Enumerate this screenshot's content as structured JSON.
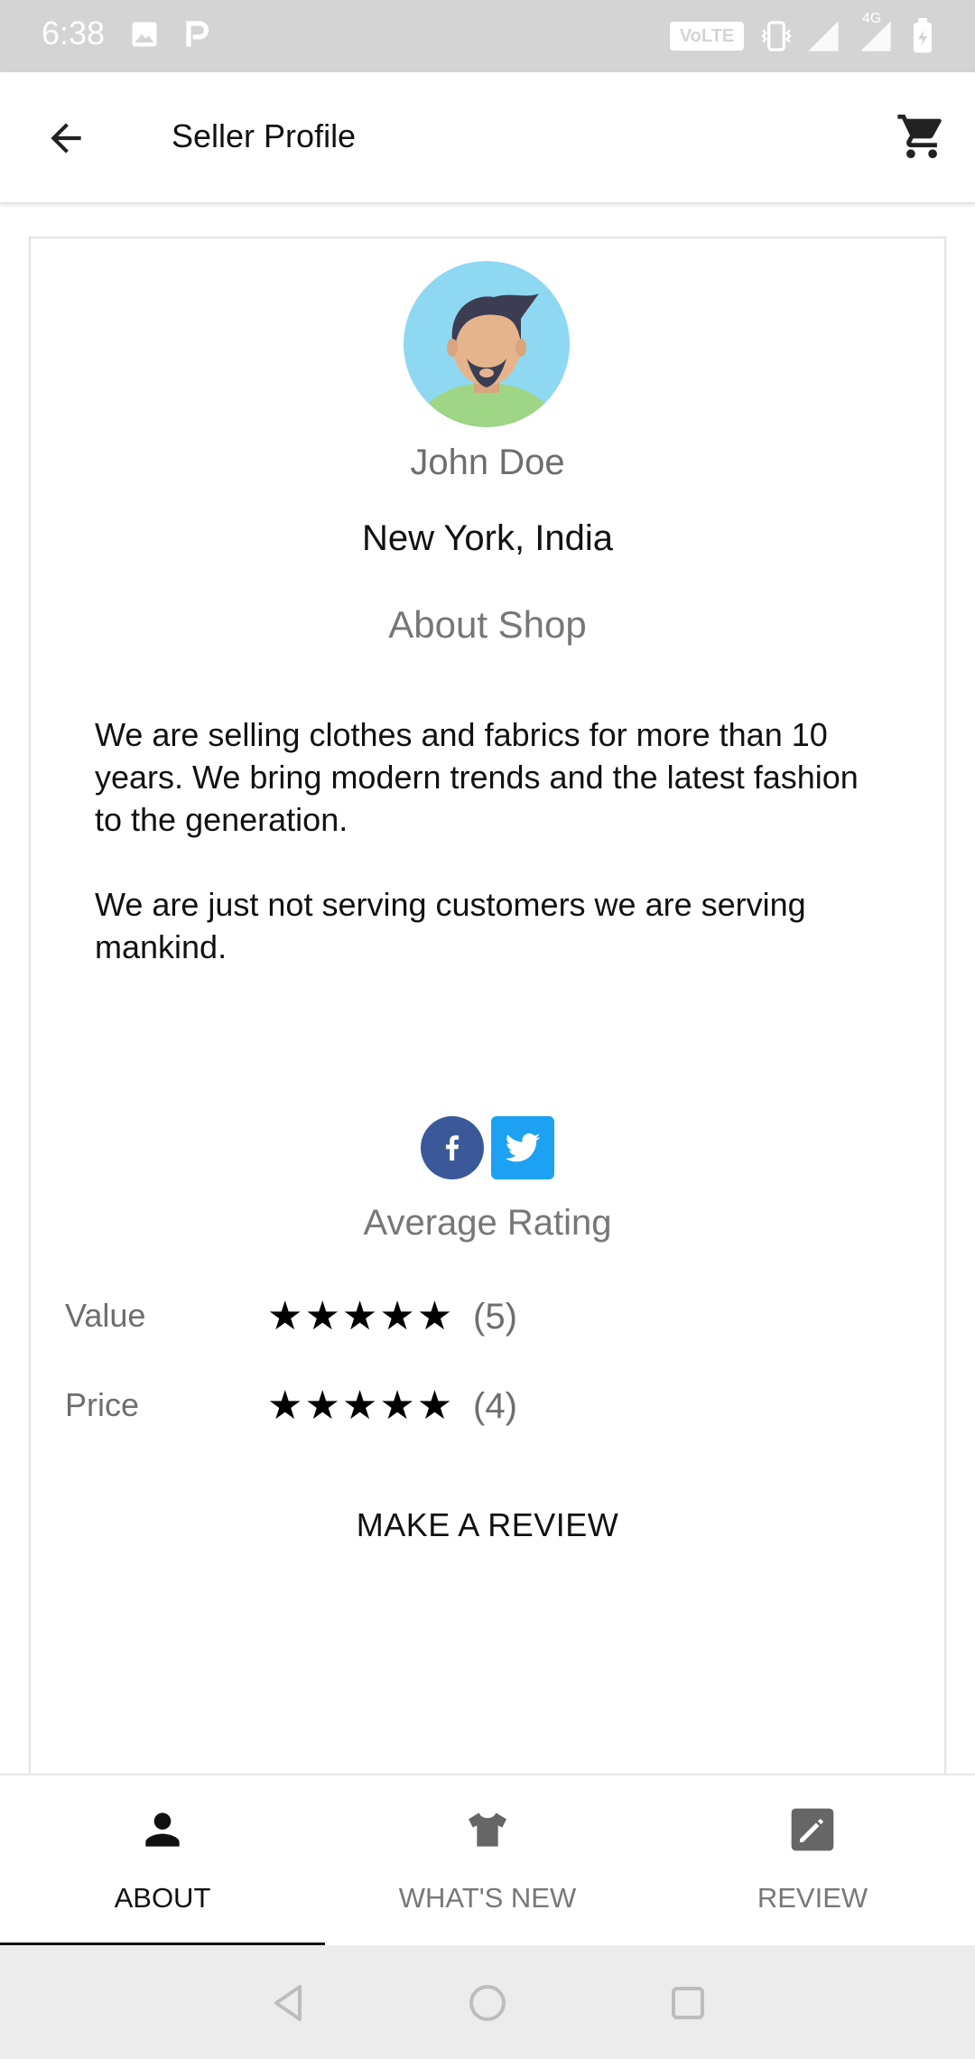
{
  "status_bar": {
    "time": "6:38",
    "volte_label": "VoLTE",
    "network_label": "4G"
  },
  "app_bar": {
    "title": "Seller Profile",
    "back_icon": "arrow-left-icon",
    "cart_icon": "shopping-cart-icon"
  },
  "profile": {
    "avatar_icon": "avatar-illustration",
    "name": "John Doe",
    "location": "New York, India",
    "about_heading": "About Shop",
    "about_paragraphs": [
      "We are selling clothes and fabrics for more than 10 years. We bring modern trends and the latest fashion to the generation.",
      "We are just not serving customers we are serving mankind."
    ]
  },
  "social": {
    "facebook_icon": "facebook-icon",
    "twitter_icon": "twitter-icon"
  },
  "ratings": {
    "heading": "Average Rating",
    "rows": [
      {
        "label": "Value",
        "stars": "★★★★★",
        "count": "(5)",
        "rating": 5
      },
      {
        "label": "Price",
        "stars": "★★★★★",
        "count": "(4)",
        "rating": 5
      }
    ]
  },
  "review_button": {
    "label": "MAKE A REVIEW"
  },
  "bottom_nav": {
    "tabs": [
      {
        "label": "ABOUT",
        "icon": "person-icon",
        "active": true
      },
      {
        "label": "WHAT'S NEW",
        "icon": "tshirt-icon",
        "active": false
      },
      {
        "label": "REVIEW",
        "icon": "edit-icon",
        "active": false
      }
    ]
  },
  "system_nav": {
    "back_icon": "triangle-back-icon",
    "home_icon": "circle-home-icon",
    "recents_icon": "square-recents-icon"
  },
  "colors": {
    "status_bar": "#d4d4d4",
    "facebook": "#3b5998",
    "twitter": "#1da1f2",
    "avatar_bg": "#8fd8f2",
    "muted_text": "#777777"
  }
}
